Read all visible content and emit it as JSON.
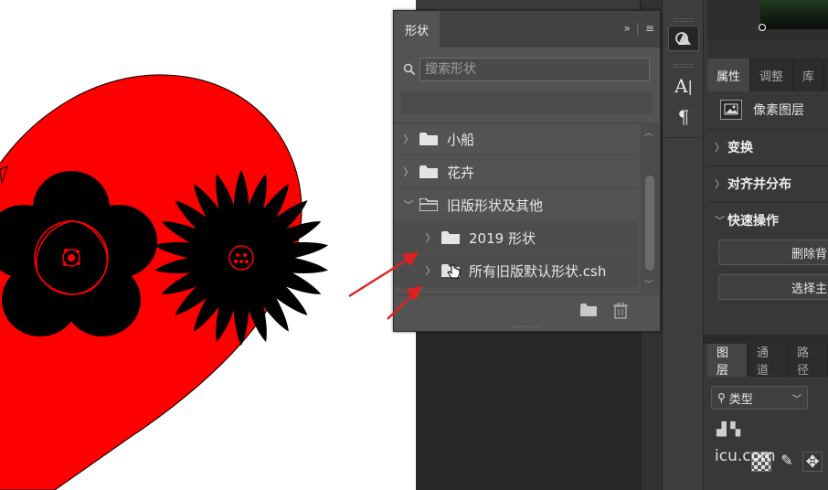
{
  "shapes_panel": {
    "tab_label": "形状",
    "collapse_label": "»",
    "search_placeholder": "搜索形状",
    "items": [
      {
        "label": "小船",
        "expanded": false
      },
      {
        "label": "花卉",
        "expanded": false
      },
      {
        "label": "旧版形状及其他",
        "expanded": true
      },
      {
        "label": "2019 形状",
        "expanded": false
      },
      {
        "label": "所有旧版默认形状.csh",
        "expanded": false
      }
    ]
  },
  "tools": {
    "text_tool": "A",
    "paragraph_tool": "¶"
  },
  "properties_panel": {
    "tabs": [
      "属性",
      "调整",
      "库"
    ],
    "layer_type": "像素图层",
    "sections": [
      "变换",
      "对齐并分布",
      "快速操作"
    ],
    "buttons": [
      "删除背",
      "选择主"
    ]
  },
  "layers_panel": {
    "tabs": [
      "图层",
      "通道",
      "路径"
    ],
    "filter_label": "类型"
  },
  "watermark": "icu.com",
  "colors": {
    "heart": "#ff0000",
    "arrow": "#e02020",
    "panel_bg": "#535353"
  }
}
